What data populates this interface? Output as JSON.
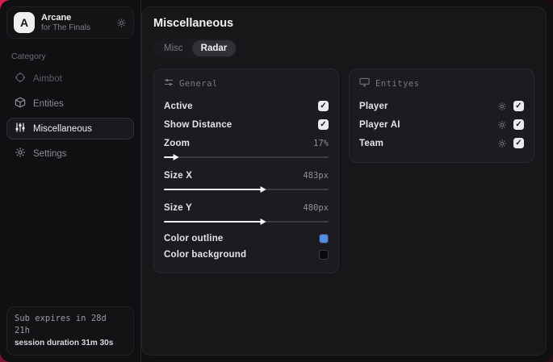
{
  "app": {
    "name": "Arcane",
    "subtitle": "for The Finals",
    "logo_letter": "A"
  },
  "sidebar": {
    "category_label": "Category",
    "items": [
      {
        "label": "Aimbot",
        "icon": "crosshair-icon",
        "active": false
      },
      {
        "label": "Entities",
        "icon": "cube-icon",
        "active": false
      },
      {
        "label": "Miscellaneous",
        "icon": "sliders-icon",
        "active": true
      },
      {
        "label": "Settings",
        "icon": "gear-icon",
        "active": false
      }
    ],
    "footer": {
      "line1": "Sub expires in 28d 21h",
      "line2": "session duration 31m 30s"
    }
  },
  "main": {
    "title": "Miscellaneous",
    "tabs": [
      {
        "label": "Misc",
        "active": false
      },
      {
        "label": "Radar",
        "active": true
      }
    ],
    "panels": {
      "general": {
        "title": "General",
        "icon": "mini-sliders-icon",
        "toggles": [
          {
            "label": "Active",
            "checked": true
          },
          {
            "label": "Show Distance",
            "checked": true
          }
        ],
        "sliders": [
          {
            "label": "Zoom",
            "value": "17%",
            "fill_percent": 7
          },
          {
            "label": "Size X",
            "value": "483px",
            "fill_percent": 60
          },
          {
            "label": "Size Y",
            "value": "480px",
            "fill_percent": 60
          }
        ],
        "colors": [
          {
            "label": "Color outline",
            "swatch": "#528de0"
          },
          {
            "label": "Color background",
            "swatch": "#0a0a0c"
          }
        ]
      },
      "entities": {
        "title": "Entityes",
        "icon": "monitor-icon",
        "rows": [
          {
            "label": "Player",
            "checked": true
          },
          {
            "label": "Player AI",
            "checked": true
          },
          {
            "label": "Team",
            "checked": true
          }
        ]
      }
    }
  },
  "colors": {
    "accent_red": "#d02450",
    "swatch_blue": "#528de0",
    "swatch_black": "#0a0a0c"
  }
}
